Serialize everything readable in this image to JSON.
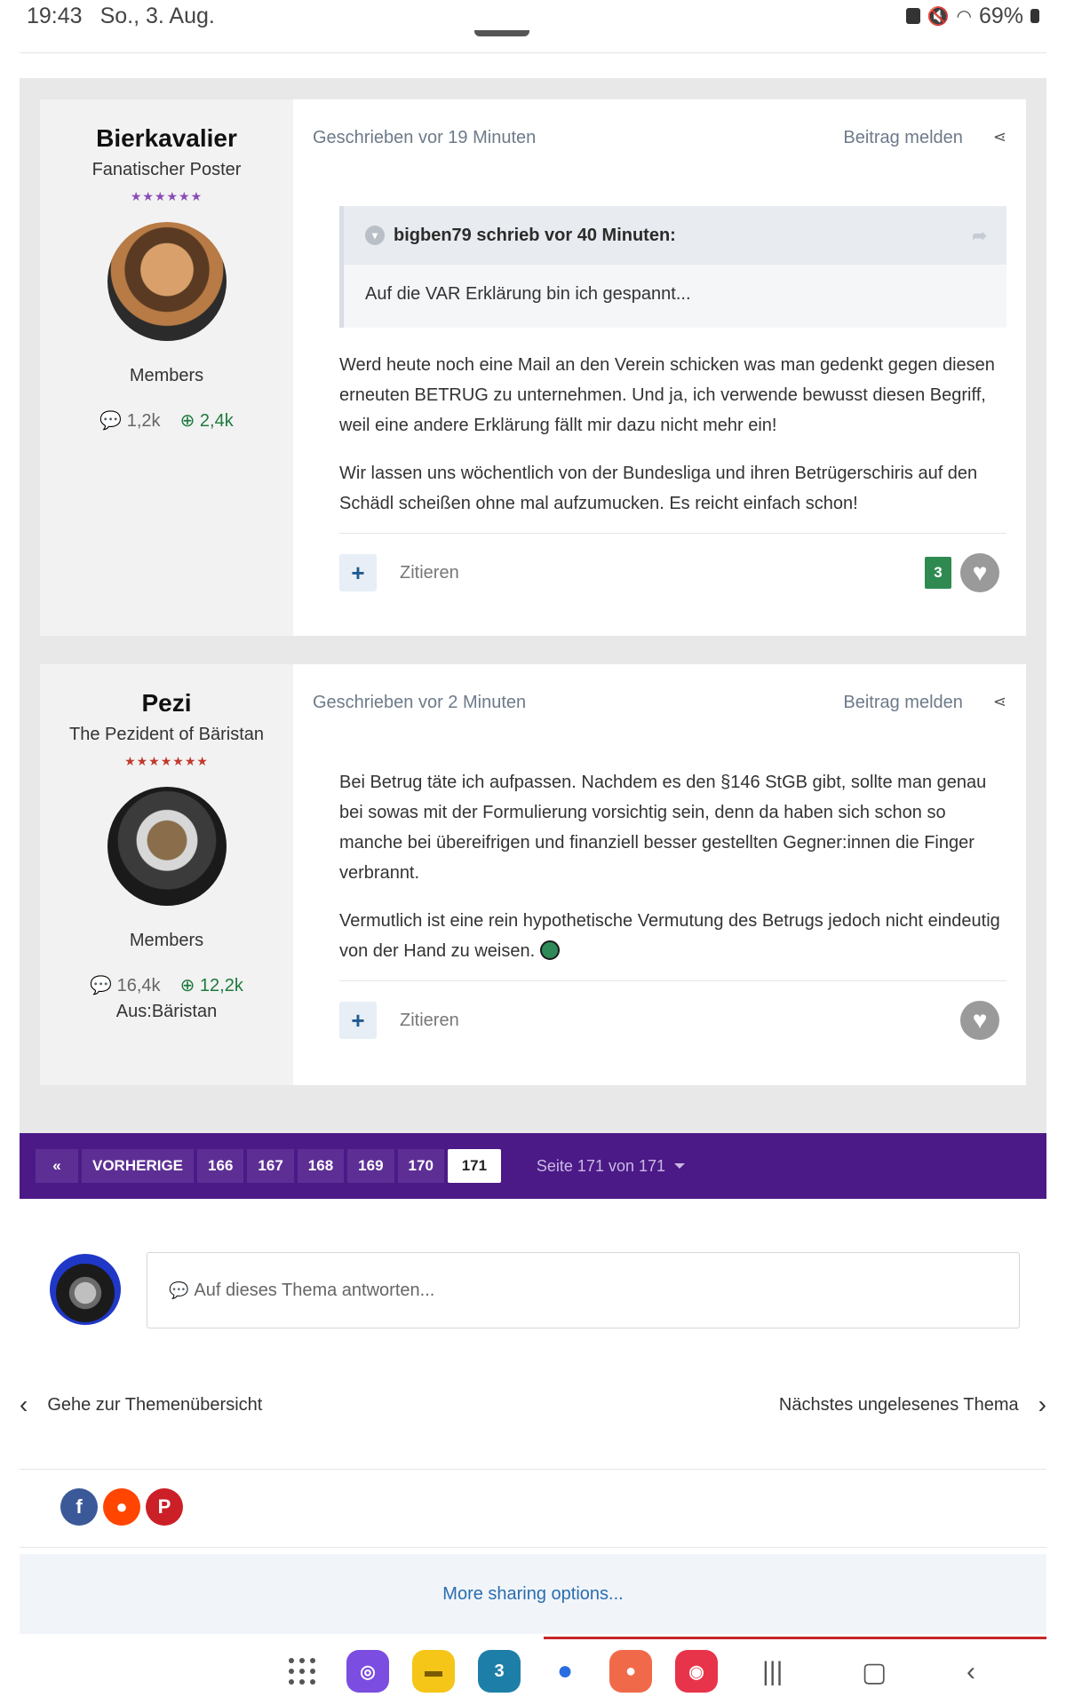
{
  "statusbar": {
    "time": "19:43",
    "date": "So., 3. Aug.",
    "battery": "69%"
  },
  "posts": [
    {
      "author": "Bierkavalier",
      "rank": "Fanatischer Poster",
      "stars": "★★★★★★",
      "group": "Members",
      "post_count": "1,2k",
      "reputation": "2,4k",
      "location": "",
      "written": "Geschrieben vor 19 Minuten",
      "report": "Beitrag melden",
      "quote": {
        "header": "bigben79 schrieb vor 40 Minuten:",
        "text": "Auf die VAR Erklärung bin ich gespannt..."
      },
      "paragraphs": [
        "Werd heute noch eine Mail an den Verein schicken was man gedenkt gegen diesen erneuten BETRUG zu unternehmen. Und ja, ich verwende bewusst diesen Begriff, weil eine andere Erklärung fällt mir dazu nicht mehr ein!",
        "Wir lassen uns wöchentlich von der Bundesliga und ihren Betrügerschiris auf den Schädl scheißen ohne mal aufzumucken. Es reicht einfach schon!"
      ],
      "quote_action": "Zitieren",
      "reactions": "3"
    },
    {
      "author": "Pezi",
      "rank": "The Pezident of Bäristan",
      "stars": "★★★★★★★",
      "group": "Members",
      "post_count": "16,4k",
      "reputation": "12,2k",
      "location": "Aus:Bäristan",
      "written": "Geschrieben vor 2 Minuten",
      "report": "Beitrag melden",
      "paragraphs": [
        "Bei Betrug täte ich aufpassen. Nachdem es den §146 StGB gibt, sollte man genau bei sowas mit der Formulierung vorsichtig sein, denn da haben sich schon so manche bei übereifrigen und finanziell besser gestellten Gegner:innen die Finger verbrannt.",
        "Vermutlich ist eine rein hypothetische Vermutung des Betrugs jedoch nicht eindeutig von der Hand zu weisen."
      ],
      "quote_action": "Zitieren"
    }
  ],
  "pagination": {
    "first": "«",
    "prev": "VORHERIGE",
    "pages": [
      "166",
      "167",
      "168",
      "169",
      "170",
      "171"
    ],
    "current": "171",
    "info": "Seite 171 von 171"
  },
  "reply": {
    "placeholder": "Auf dieses Thema antworten..."
  },
  "nav": {
    "back": "Gehe zur Themenübersicht",
    "next": "Nächstes ungelesenes Thema"
  },
  "sharing": {
    "more": "More sharing options..."
  },
  "colors": {
    "accent": "#4b1a86",
    "reputation": "#1d7a3d",
    "reaction_badge": "#2f8a52",
    "link": "#2a6db0"
  }
}
